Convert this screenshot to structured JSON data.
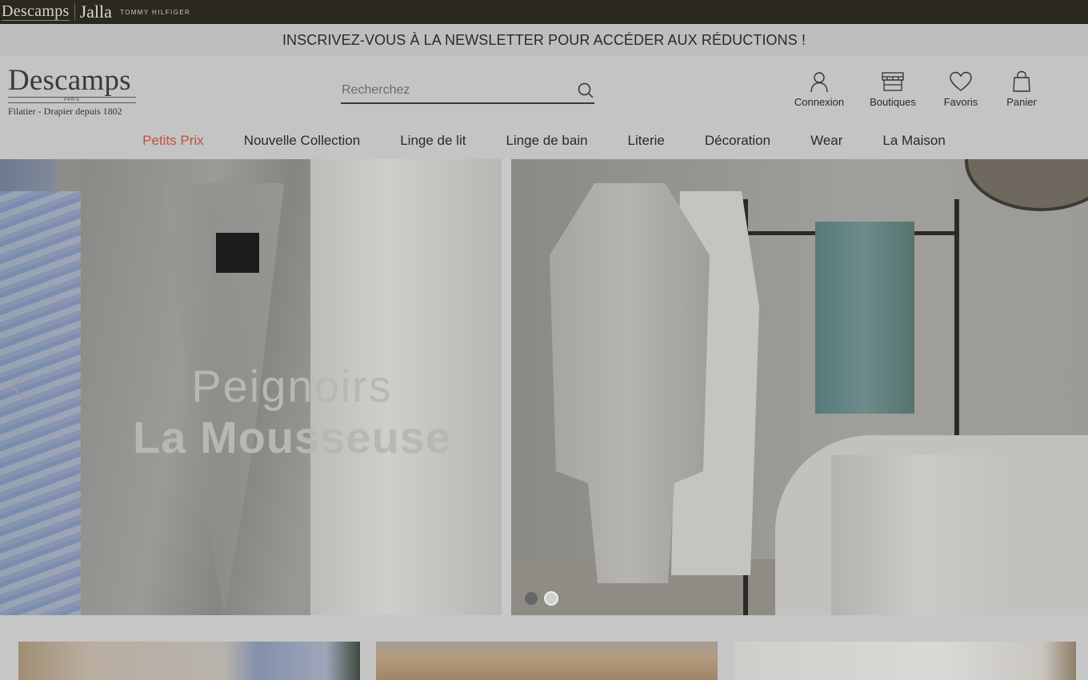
{
  "brand_bar": {
    "brands": [
      "Descamps",
      "Jalla",
      "TOMMY HILFIGER"
    ]
  },
  "newsletter": {
    "text": "INSCRIVEZ-VOUS À LA NEWSLETTER POUR ACCÉDER AUX RÉDUCTIONS !"
  },
  "logo": {
    "name": "Descamps",
    "city": "PARIS",
    "tagline": "Filatier - Drapier depuis 1802"
  },
  "search": {
    "placeholder": "Recherchez",
    "value": ""
  },
  "actions": [
    {
      "label": "Connexion",
      "icon": "user-icon"
    },
    {
      "label": "Boutiques",
      "icon": "store-icon"
    },
    {
      "label": "Favoris",
      "icon": "heart-icon"
    },
    {
      "label": "Panier",
      "icon": "bag-icon"
    }
  ],
  "nav": [
    {
      "label": "Petits Prix",
      "highlight_color": "#c0533a"
    },
    {
      "label": "Nouvelle Collection"
    },
    {
      "label": "Linge de lit"
    },
    {
      "label": "Linge de bain"
    },
    {
      "label": "Literie"
    },
    {
      "label": "Décoration"
    },
    {
      "label": "Wear"
    },
    {
      "label": "La Maison"
    }
  ],
  "hero": {
    "title_line1": "Peignoirs",
    "title_line2": "La Mousseuse",
    "slides_count": 2,
    "active_slide": 2
  },
  "colors": {
    "brand_bar_bg": "#2b2822",
    "newsletter_bg": "#bebebe",
    "header_bg": "#c4c4c4",
    "promo_nav": "#c0533a"
  }
}
